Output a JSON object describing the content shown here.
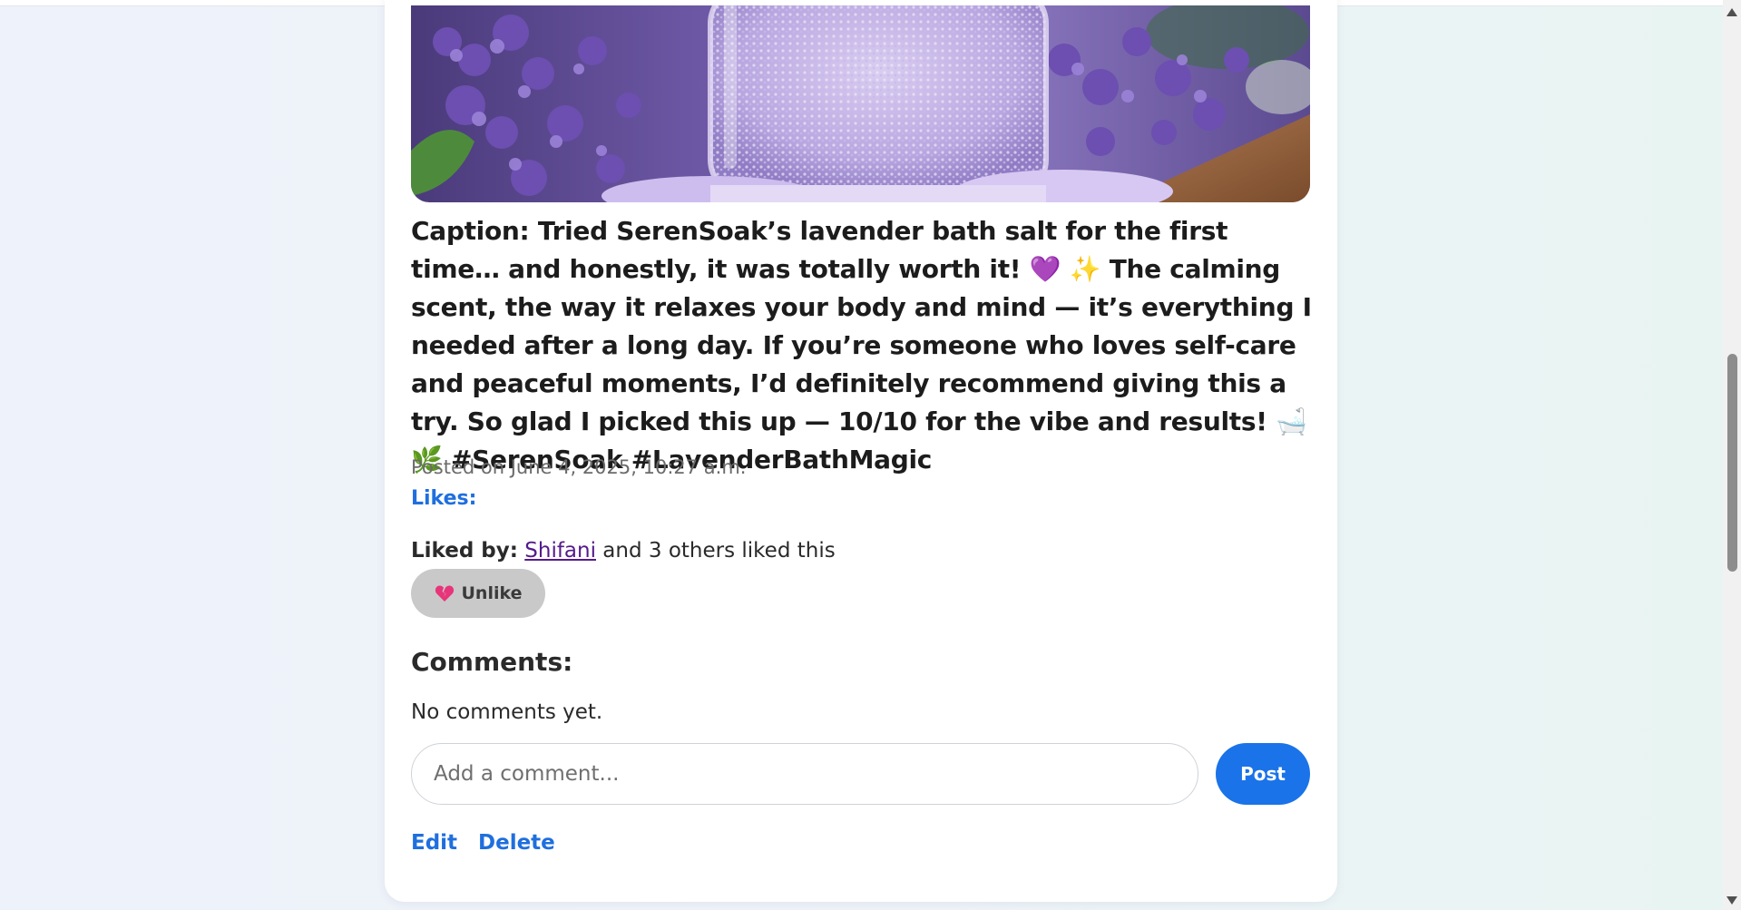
{
  "post": {
    "caption_prefix": "Caption:",
    "caption_text": "Caption: Tried SerenSoak’s lavender bath salt for the first time… and honestly, it was totally worth it! 💜 ✨ The calming scent, the way it relaxes your body and mind — it’s everything I needed after a long day. If you’re someone who loves self-care and peaceful moments, I’d definitely recommend giving this a try. So glad I picked this up — 10/10 for the vibe and results! 🛁 🌿 #SerenSoak #LavenderBathMagic",
    "timestamp": "Posted on June 4, 2025, 10:27 a.m.",
    "likes_label": "Likes:",
    "liked_by_label": "Liked by:",
    "liked_by_user": "Shifani",
    "liked_by_suffix": " and 3 others liked this",
    "unlike_label": "Unlike",
    "unlike_icon": "broken-heart-icon"
  },
  "comments": {
    "heading": "Comments:",
    "empty_text": "No comments yet.",
    "input_placeholder": "Add a comment...",
    "post_label": "Post"
  },
  "actions": {
    "edit_label": "Edit",
    "delete_label": "Delete"
  },
  "colors": {
    "accent": "#1a73e8",
    "link_blue": "#1f6fde",
    "visited_link": "#551a8b",
    "unlike_bg": "#c9c9c9",
    "lavender": "#8a6cc8"
  }
}
